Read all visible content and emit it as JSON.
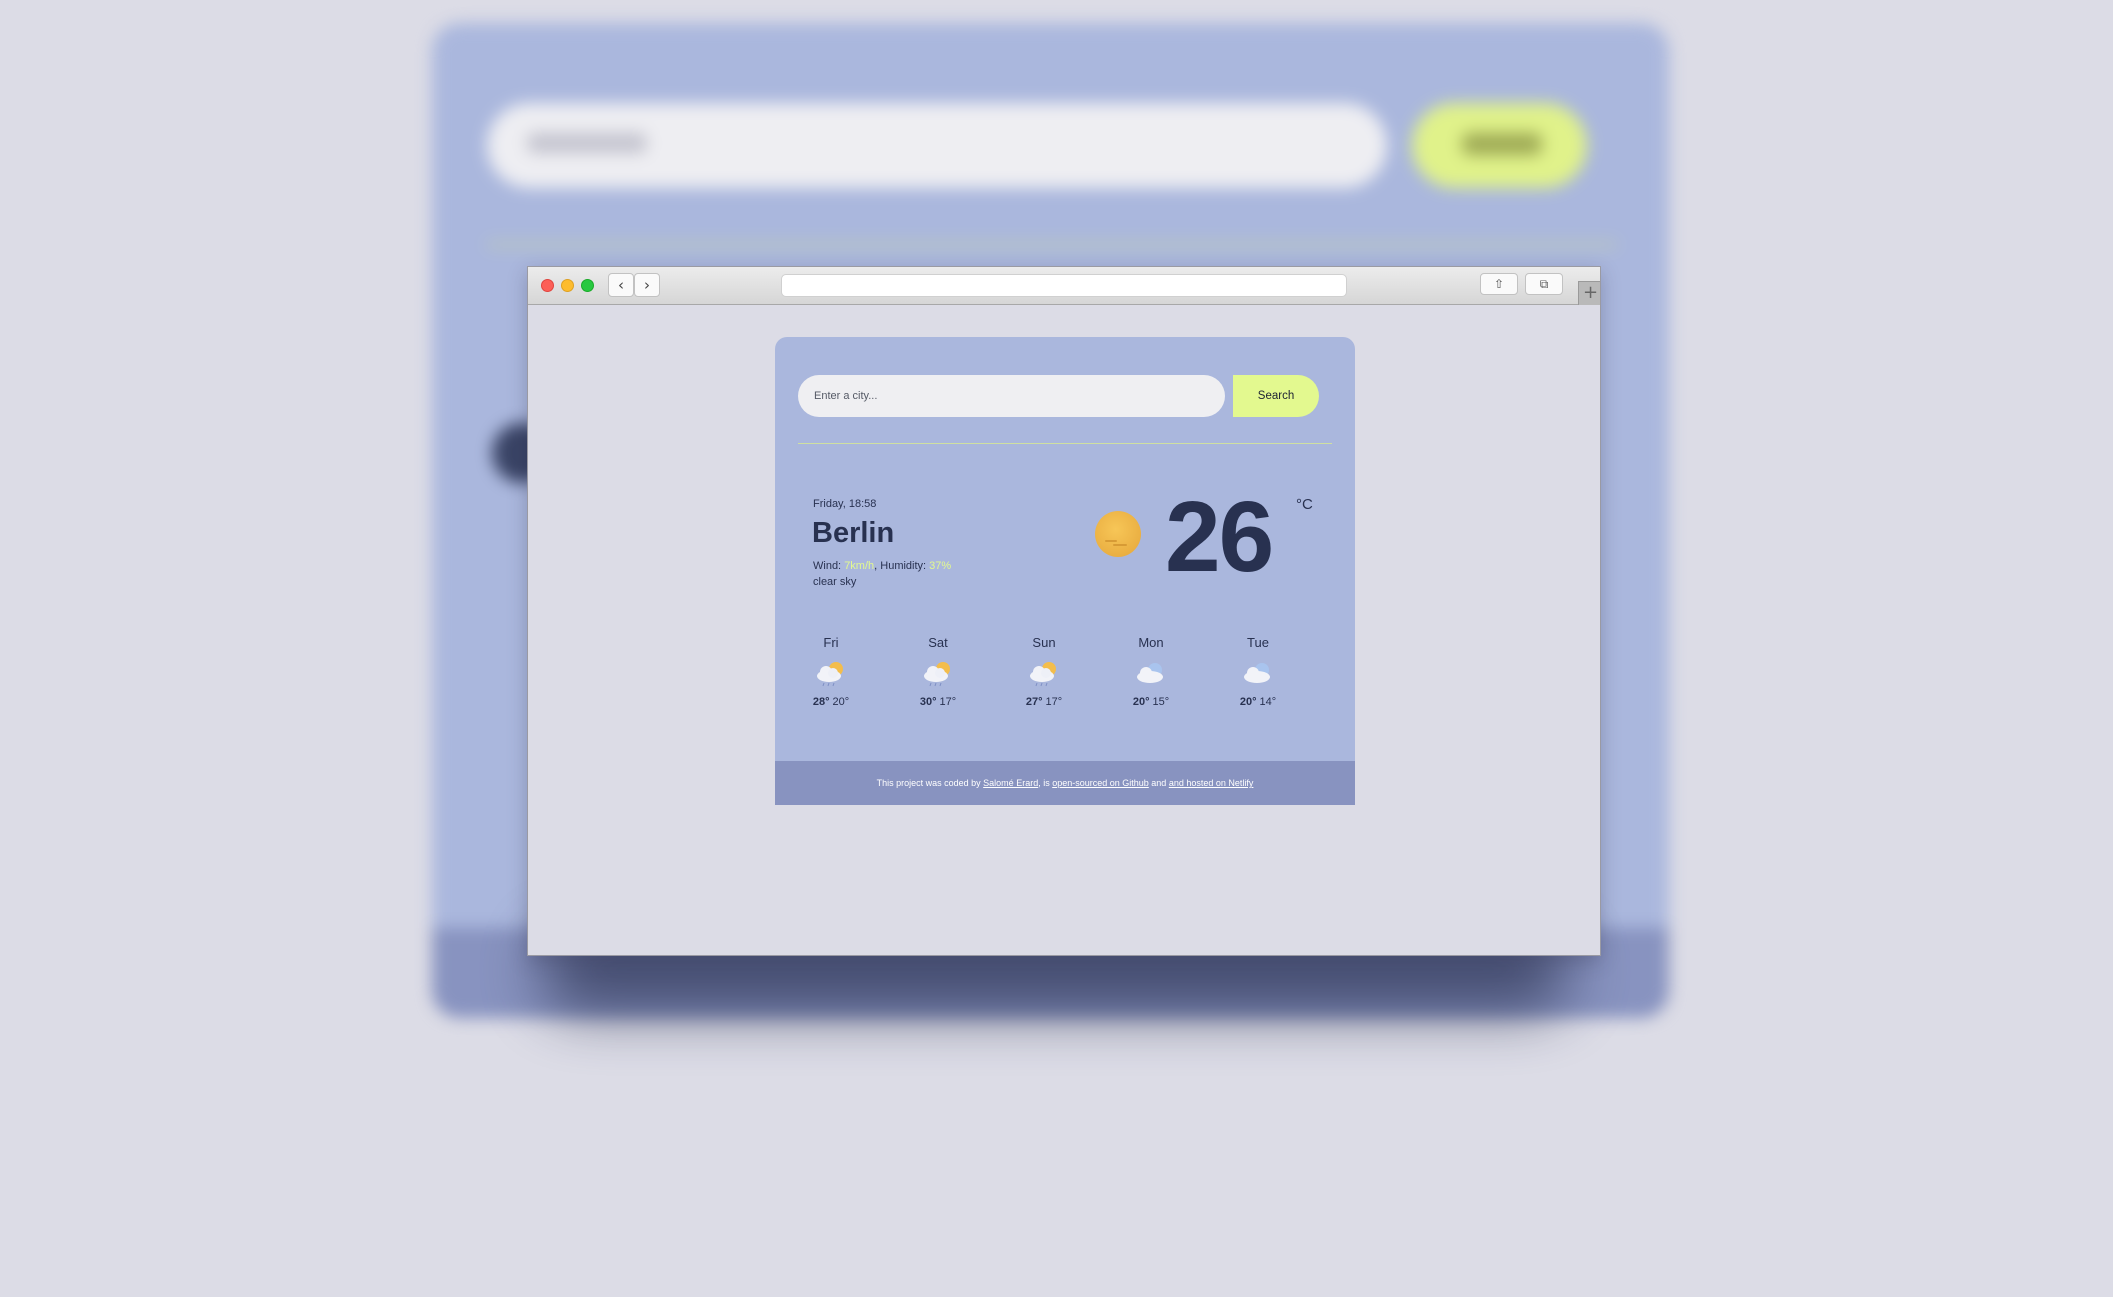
{
  "backdrop": {
    "background_color": "#aab7dd"
  },
  "browser": {
    "nav_back_icon": "chevron-left-icon",
    "nav_forward_icon": "chevron-right-icon",
    "nav_back_glyph": "‹",
    "nav_forward_glyph": "›",
    "share_glyph": "⇧",
    "tabs_glyph": "⧉",
    "plus_glyph": "+"
  },
  "search": {
    "placeholder": "Enter a city...",
    "button_label": "Search"
  },
  "current": {
    "datetime": "Friday, 18:58",
    "city": "Berlin",
    "wind_label": "Wind: ",
    "wind_value": "7km/h",
    "humidity_label": ", Humidity: ",
    "humidity_value": "37%",
    "description": "clear sky",
    "icon": "sun-icon",
    "temperature": "26",
    "unit": "°C"
  },
  "forecast": [
    {
      "day": "Fri",
      "icon": "cloud-sun-rain-icon",
      "max": "28°",
      "min": " 20°"
    },
    {
      "day": "Sat",
      "icon": "cloud-sun-rain-icon",
      "max": "30°",
      "min": " 17°"
    },
    {
      "day": "Sun",
      "icon": "cloud-sun-rain-icon",
      "max": "27°",
      "min": " 17°"
    },
    {
      "day": "Mon",
      "icon": "cloud-icon",
      "max": "20°",
      "min": " 15°"
    },
    {
      "day": "Tue",
      "icon": "cloud-icon",
      "max": "20°",
      "min": " 14°"
    }
  ],
  "footer": {
    "text_1": "This project was coded by ",
    "author": "Salomé Erard",
    "text_2": ", is ",
    "github": "open-sourced on Github",
    "text_3": " and ",
    "netlify": "and hosted on Netlify"
  },
  "colors": {
    "card": "#aab7dd",
    "accent": "#e3f98f",
    "text": "#283150",
    "footer": "#8893c0"
  }
}
